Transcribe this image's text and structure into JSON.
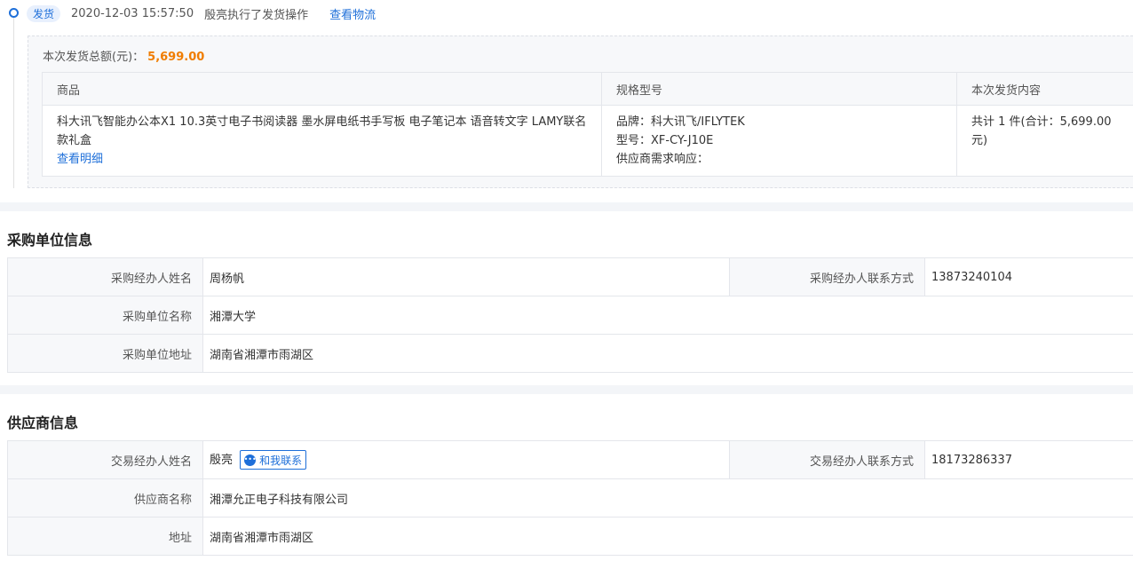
{
  "timeline": {
    "tag": "发货",
    "time": "2020-12-03 15:57:50",
    "action": "殷亮执行了发货操作",
    "logistics_link": "查看物流"
  },
  "shipment": {
    "total_label": "本次发货总额(元)：",
    "total_amount": "5,699.00",
    "headers": [
      "商品",
      "规格型号",
      "本次发货内容"
    ],
    "product_name": "科大讯飞智能办公本X1 10.3英寸电子书阅读器 墨水屏电纸书手写板 电子笔记本 语音转文字 LAMY联名款礼盒",
    "detail_link": "查看明细",
    "spec_brand": "品牌：科大讯飞/IFLYTEK",
    "spec_model": "型号：XF-CY-J10E",
    "spec_response": "供应商需求响应：",
    "content": "共计 1 件(合计：5,699.00元)"
  },
  "buyer": {
    "title": "采购单位信息",
    "agent_label": "采购经办人姓名",
    "agent_value": "周杨帆",
    "contact_label": "采购经办人联系方式",
    "contact_value": "13873240104",
    "unit_label": "采购单位名称",
    "unit_value": "湘潭大学",
    "address_label": "采购单位地址",
    "address_value": "湖南省湘潭市雨湖区"
  },
  "supplier": {
    "title": "供应商信息",
    "agent_label": "交易经办人姓名",
    "agent_value": "殷亮",
    "contact_button": "和我联系",
    "contact_label": "交易经办人联系方式",
    "contact_value": "18173286337",
    "name_label": "供应商名称",
    "name_value": "湘潭允正电子科技有限公司",
    "address_label": "地址",
    "address_value": "湖南省湘潭市雨湖区"
  },
  "colors": {
    "accent": "#1e6fd9",
    "amount": "#f07d00"
  }
}
